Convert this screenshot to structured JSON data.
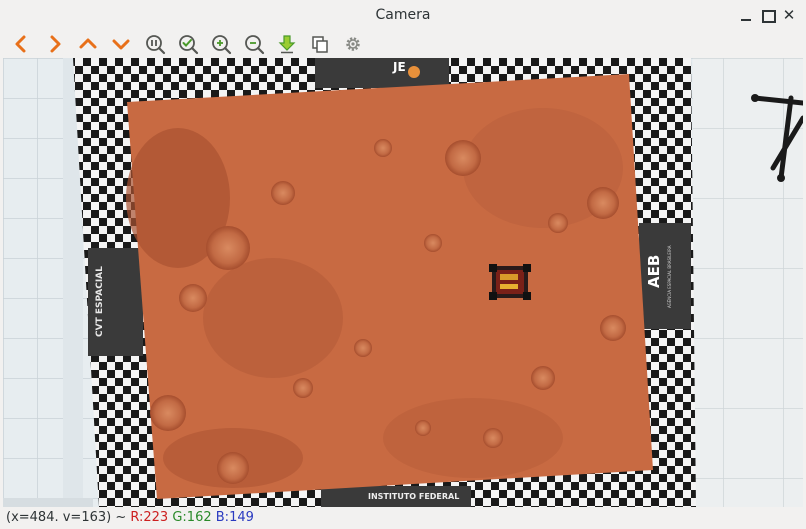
{
  "window": {
    "title": "Camera"
  },
  "toolbar": {
    "buttons": [
      {
        "name": "previous",
        "icon": "chevron-left-icon"
      },
      {
        "name": "next",
        "icon": "chevron-right-icon"
      },
      {
        "name": "up",
        "icon": "chevron-up-icon"
      },
      {
        "name": "down",
        "icon": "chevron-down-icon"
      },
      {
        "name": "pause",
        "icon": "pause-zoom-icon"
      },
      {
        "name": "confirm",
        "icon": "check-zoom-icon"
      },
      {
        "name": "zoom-in",
        "icon": "zoom-in-icon"
      },
      {
        "name": "zoom-out",
        "icon": "zoom-out-icon"
      },
      {
        "name": "save",
        "icon": "download-arrow-icon"
      },
      {
        "name": "copy",
        "icon": "copy-icon"
      },
      {
        "name": "settings",
        "icon": "gear-icon"
      }
    ]
  },
  "status": {
    "coords": "(x=484. v=163) ~",
    "r": "R:223",
    "g": "G:162",
    "b": "B:149"
  },
  "colors": {
    "toolbar_orange": "#e8701a",
    "toolbar_green": "#4a9a2a",
    "toolbar_gray": "#555753",
    "mars_surface": "#c86a42",
    "banner_dark": "#3a3a3a"
  },
  "scene": {
    "left_banner": "CVT ESPACIAL",
    "right_banner": "AEB",
    "right_banner_sub": "AGÊNCIA ESPACIAL BRASILEIRA",
    "bottom_banner": "INSTITUTO FEDERAL",
    "top_banner": "JE"
  }
}
